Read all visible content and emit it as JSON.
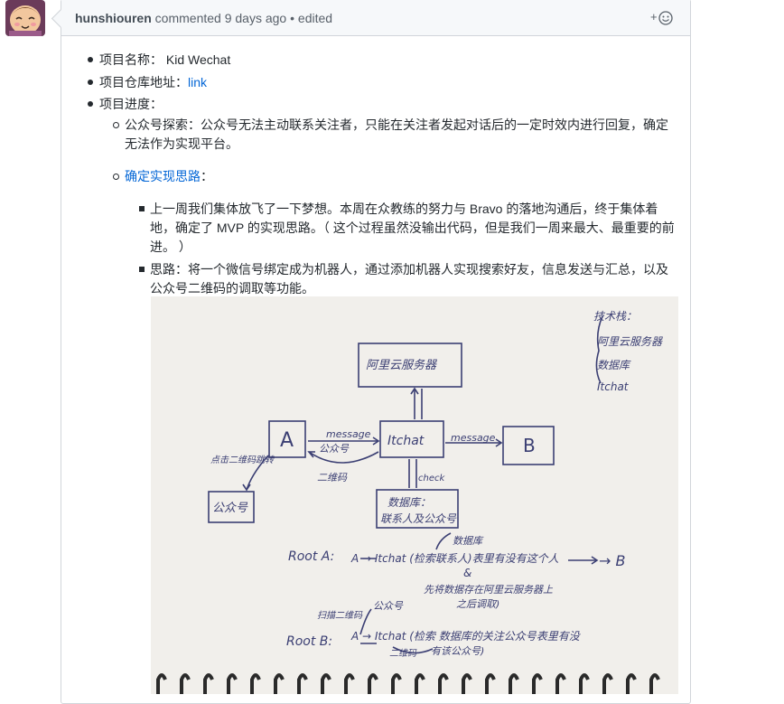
{
  "comment": {
    "author": "hunshiouren",
    "action": " commented ",
    "time": "9 days ago",
    "separator": " • ",
    "edited": "edited",
    "reaction_plus": "+"
  },
  "project": {
    "name_label": "项目名称：",
    "name_value": " Kid Wechat",
    "repo_label": "项目仓库地址：",
    "repo_link": "link",
    "progress_label": "项目进度：",
    "explore_label": "公众号探索：",
    "explore_text": "公众号无法主动联系关注者，只能在关注者发起对话后的一定时效内进行回复，确定",
    "explore_text2": "无法作为实现平台。",
    "approach_link": "确定实现思路",
    "approach_colon": "：",
    "bullet1_line1": "上一周我们集体放飞了一下梦想。本周在众教练的努力与 Bravo 的落地沟通后，终于集体着",
    "bullet1_line2": "地，确定了 MVP 的实现思路。（ 这个过程虽然没输出代码，但是我们一周来最大、最重要的前",
    "bullet1_line3": "进。 ）",
    "bullet2_line1": "思路：将一个微信号绑定成为机器人，通过添加机器人实现搜索好友，信息发送与汇总，以及",
    "bullet2_line2": "公众号二维码的调取等功能。"
  },
  "sketch": {
    "tech_title": "技术栈：",
    "tech_1": "阿里云服务器",
    "tech_2": "数据库",
    "tech_3": "Itchat",
    "server": "阿里云服务器",
    "node_a": "A",
    "node_b": "B",
    "itchat": "Itchat",
    "message_1": "message",
    "message_2": "message",
    "gzh_small": "公众号",
    "qr": "二维码",
    "scan": "点击二维码跳转",
    "gzh": "公众号",
    "db_line1": "数据库：",
    "db_line2": "联系人及公众号",
    "check": "check",
    "route_a": "Root A:",
    "route_a_chain": "A → Itchat (检索联系人)表里有没有这个人",
    "route_a_b": "→ B",
    "route_a_note1": "数据库",
    "route_a_and": "&",
    "route_a_note2": "先将数据存在阿里云服务器上",
    "route_a_note3": "之后调取)",
    "route_b": "Root B:",
    "route_b_scan": "扫描二维码",
    "route_b_gzh": "公众号",
    "route_b_chain": "A → Itchat (检索 数据库的关注公众号表里有没",
    "route_b_note": "二维码",
    "route_b_tail": "有该公众号)"
  }
}
